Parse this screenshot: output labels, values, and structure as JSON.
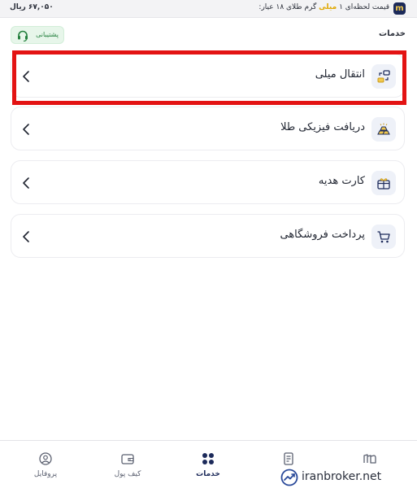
{
  "ticker": {
    "logo": "m",
    "text_before": "قیمت لحظه‌ای ۱",
    "text_highlight": "میلی",
    "text_after": "گرم طلای ۱۸ عیار:",
    "price": "۶۷,۰۵۰ ریال",
    "highlight_color": "#e0a800"
  },
  "header": {
    "title": "خدمات",
    "support_label": "پشتیبانی",
    "support_icon": "headset-icon"
  },
  "services": [
    {
      "label": "انتقال میلی",
      "icon": "transfer-icon"
    },
    {
      "label": "دریافت فیزیکی طلا",
      "icon": "gold-bars-icon"
    },
    {
      "label": "کارت هدیه",
      "icon": "gift-card-icon"
    },
    {
      "label": "پرداخت فروشگاهی",
      "icon": "shopping-cart-icon"
    }
  ],
  "bottom_nav": [
    {
      "label": "",
      "icon": "market-icon"
    },
    {
      "label": "",
      "icon": "document-icon"
    },
    {
      "label": "خدمات",
      "icon": "services-grid-icon",
      "active": true
    },
    {
      "label": "کیف پول",
      "icon": "wallet-icon"
    },
    {
      "label": "پروفایل",
      "icon": "profile-icon"
    }
  ],
  "watermark": "iranbroker.net",
  "colors": {
    "accent": "#1c2a5a",
    "highlight_box": "#e31313",
    "support_bg": "#e7f6ea",
    "support_text": "#24803e"
  }
}
